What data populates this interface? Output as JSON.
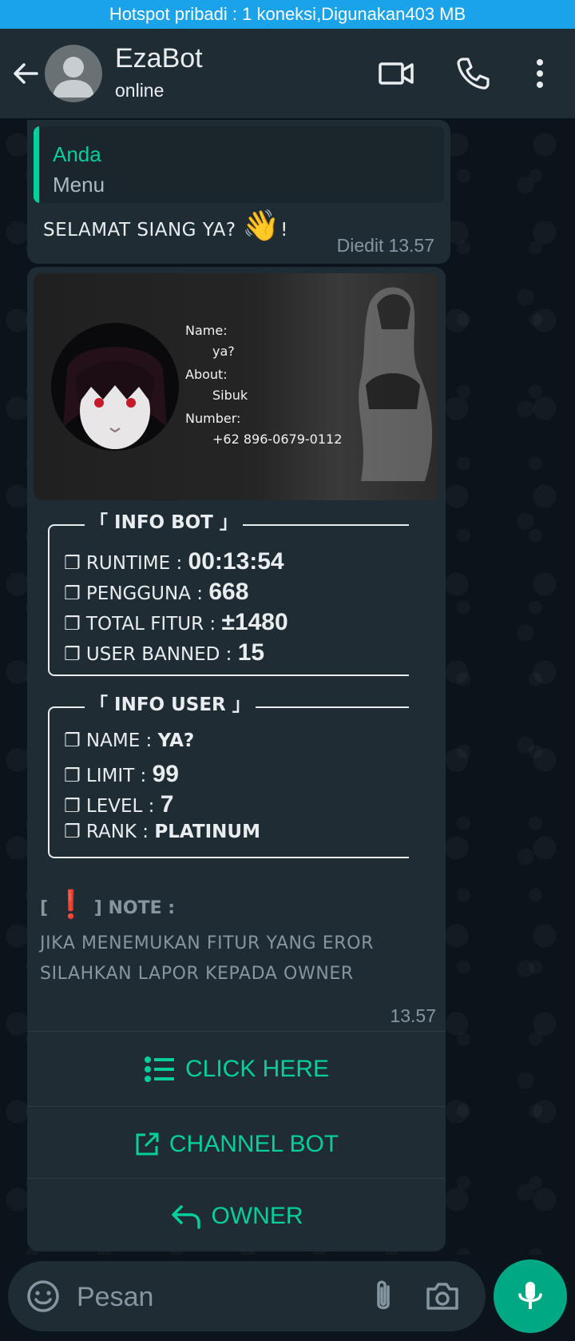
{
  "status_bar": {
    "hotspot_text": "Hotspot pribadi : 1 koneksi,Digunakan403 MB"
  },
  "header": {
    "contact_name": "EzaBot",
    "status": "online"
  },
  "message1": {
    "quote_author": "Anda",
    "quote_text": "Menu",
    "text": "SELAMAT SIANG YA?",
    "emoji": "👋",
    "suffix": "!",
    "edited_label": "Diedit",
    "time": "13.57"
  },
  "profile_card": {
    "name_label": "Name:",
    "name_value": "ya?",
    "about_label": "About:",
    "about_value": "Sibuk",
    "number_label": "Number:",
    "number_value": "+62 896-0679-0112"
  },
  "info_bot": {
    "title": "「 INFO BOT 」",
    "rows": [
      {
        "label": "❐ RUNTIME : ",
        "value": "00:13:54"
      },
      {
        "label": "❐ PENGGUNA : ",
        "value": "668"
      },
      {
        "label": "❐ TOTAL FITUR : ",
        "value": "±1480"
      },
      {
        "label": "❐ USER BANNED : ",
        "value": "15"
      }
    ]
  },
  "info_user": {
    "title": "「 INFO USER 」",
    "rows": [
      {
        "label": "❐ NAME : ",
        "value": "YA?"
      },
      {
        "label": "❐ LIMIT : ",
        "value": "99"
      },
      {
        "label": "❐ LEVEL : ",
        "value": "7"
      },
      {
        "label": "❐ RANK : ",
        "value": "PLATINUM"
      }
    ]
  },
  "note": {
    "open": "[",
    "mark": "❗",
    "close": "]",
    "label": "NOTE :",
    "line1": "JIKA MENEMUKAN FITUR YANG EROR",
    "line2": "SILAHKAN LAPOR KEPADA OWNER",
    "time": "13.57"
  },
  "buttons": {
    "click_here": "CLICK HERE",
    "channel_bot": "CHANNEL BOT",
    "owner": "OWNER"
  },
  "composer": {
    "placeholder": "Pesan"
  },
  "colors": {
    "accent": "#06cf9c",
    "mic_button": "#00a884",
    "hotspot_bar": "#1aa3e8",
    "bubble": "#1f2c34",
    "background": "#0b141a"
  }
}
